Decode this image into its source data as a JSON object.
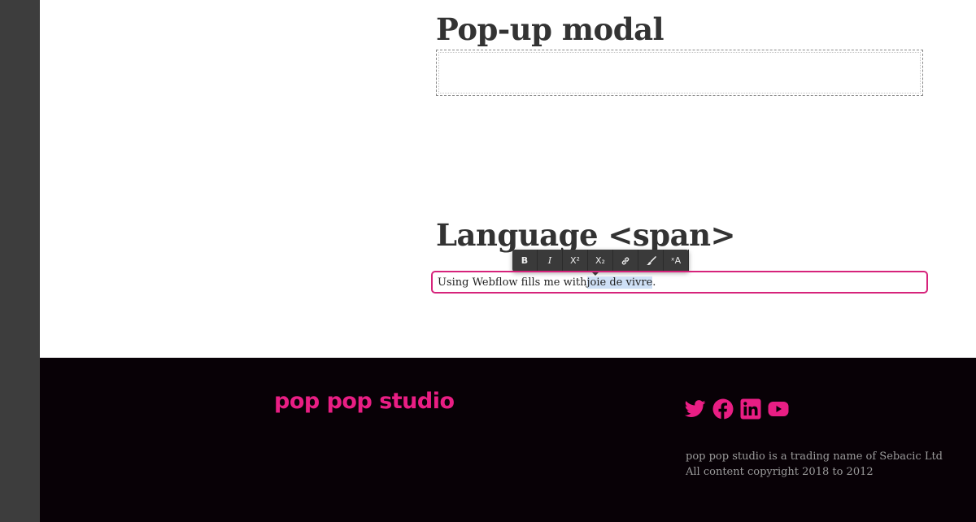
{
  "content": {
    "modal_heading": "Pop-up modal",
    "language_heading": "Language <span>",
    "field": {
      "text_before": "Using Webflow fills me with ",
      "text_selected": "joie de vivre",
      "text_after": "."
    }
  },
  "toolbar": {
    "bold": "B",
    "italic": "I",
    "superscript": "X²",
    "subscript": "X₂",
    "clear_format": "ˣA"
  },
  "footer": {
    "logo": "pop pop studio",
    "legal_line1": "pop pop studio is a trading name of Sebacic Ltd",
    "legal_line2": "All content copyright 2018 to 2012",
    "social_icons": [
      "twitter-icon",
      "facebook-icon",
      "linkedin-icon",
      "youtube-icon"
    ]
  },
  "colors": {
    "accent": "#e91e84",
    "field_border": "#d6237b",
    "footer_bg": "#080106",
    "rail": "#3d3d3d"
  }
}
